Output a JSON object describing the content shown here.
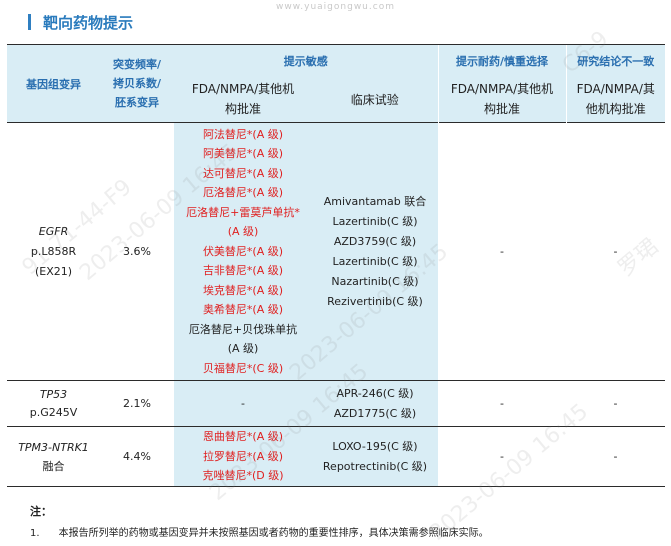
{
  "watermark": {
    "url": "www.yuaigongwu.com",
    "texts": [
      "2023-06-09 16:45",
      "2023-06-09 16:45",
      "2023-06-09 16:45",
      "2023-06-09 16:45",
      "91-71-44-F9",
      "C6-9",
      "罗珺"
    ]
  },
  "title": "靶向药物提示",
  "header": {
    "col_gene": "基因组变异",
    "col_freq": [
      "突变频率/",
      "拷贝系数/",
      "胚系变异"
    ],
    "col_sens": "提示敏感",
    "col_resist": "提示耐药/慎重选择",
    "col_conflict": "研究结论不一致",
    "sub_fda": [
      "FDA/NMPA/其他机",
      "构批准"
    ],
    "sub_clin": "临床试验",
    "sub_fda_resist": [
      "FDA/NMPA/其他机",
      "构批准"
    ],
    "sub_fda_conflict": [
      "FDA/NMPA/其",
      "他机构批准"
    ]
  },
  "rows": [
    {
      "gene": "EGFR",
      "variant": [
        "p.L858R",
        "(EX21)"
      ],
      "freq": "3.6%",
      "approved": [
        {
          "text": "阿法替尼*(A 级)",
          "color": "red"
        },
        {
          "text": "阿美替尼*(A 级)",
          "color": "red"
        },
        {
          "text": "达可替尼*(A 级)",
          "color": "red"
        },
        {
          "text": "厄洛替尼*(A 级)",
          "color": "red"
        },
        {
          "text": "厄洛替尼+雷莫芦单抗*",
          "color": "red"
        },
        {
          "text": "(A 级)",
          "color": "red"
        },
        {
          "text": "伏美替尼*(A 级)",
          "color": "red"
        },
        {
          "text": "吉非替尼*(A 级)",
          "color": "red"
        },
        {
          "text": "埃克替尼*(A 级)",
          "color": "red"
        },
        {
          "text": "奥希替尼*(A 级)",
          "color": "red"
        },
        {
          "text": "厄洛替尼+贝伐珠单抗",
          "color": "black"
        },
        {
          "text": "(A 级)",
          "color": "black"
        },
        {
          "text": "贝福替尼*(C 级)",
          "color": "red"
        }
      ],
      "clinical": [
        "Amivantamab 联合",
        "Lazertinib(C 级)",
        "AZD3759(C 级)",
        "Lazertinib(C 级)",
        "Nazartinib(C 级)",
        "Rezivertinib(C 级)"
      ],
      "resist": "-",
      "conflict": "-"
    },
    {
      "gene": "TP53",
      "variant": [
        "p.G245V"
      ],
      "freq": "2.1%",
      "approved": [
        {
          "text": "-",
          "color": "black"
        }
      ],
      "clinical": [
        "APR-246(C 级)",
        "AZD1775(C 级)"
      ],
      "resist": "-",
      "conflict": "-"
    },
    {
      "gene": "TPM3-NTRK1",
      "variant": [
        "融合"
      ],
      "freq": "4.4%",
      "approved": [
        {
          "text": "恩曲替尼*(A 级)",
          "color": "red"
        },
        {
          "text": "拉罗替尼*(A 级)",
          "color": "red"
        },
        {
          "text": "克唑替尼*(D 级)",
          "color": "red"
        }
      ],
      "clinical": [
        "LOXO-195(C 级)",
        "Repotrectinib(C 级)"
      ],
      "resist": "-",
      "conflict": "-"
    }
  ],
  "notes": {
    "title": "注：",
    "items": [
      {
        "num": "1.",
        "text": "本报告所列举的药物或基因变异并未按照基因或者药物的重要性排序，具体决策需参照临床实际。"
      }
    ]
  },
  "colors": {
    "accent": "#2a7bbd",
    "header_bg": "#d9edf5",
    "sensitive_red": "#e02020"
  }
}
